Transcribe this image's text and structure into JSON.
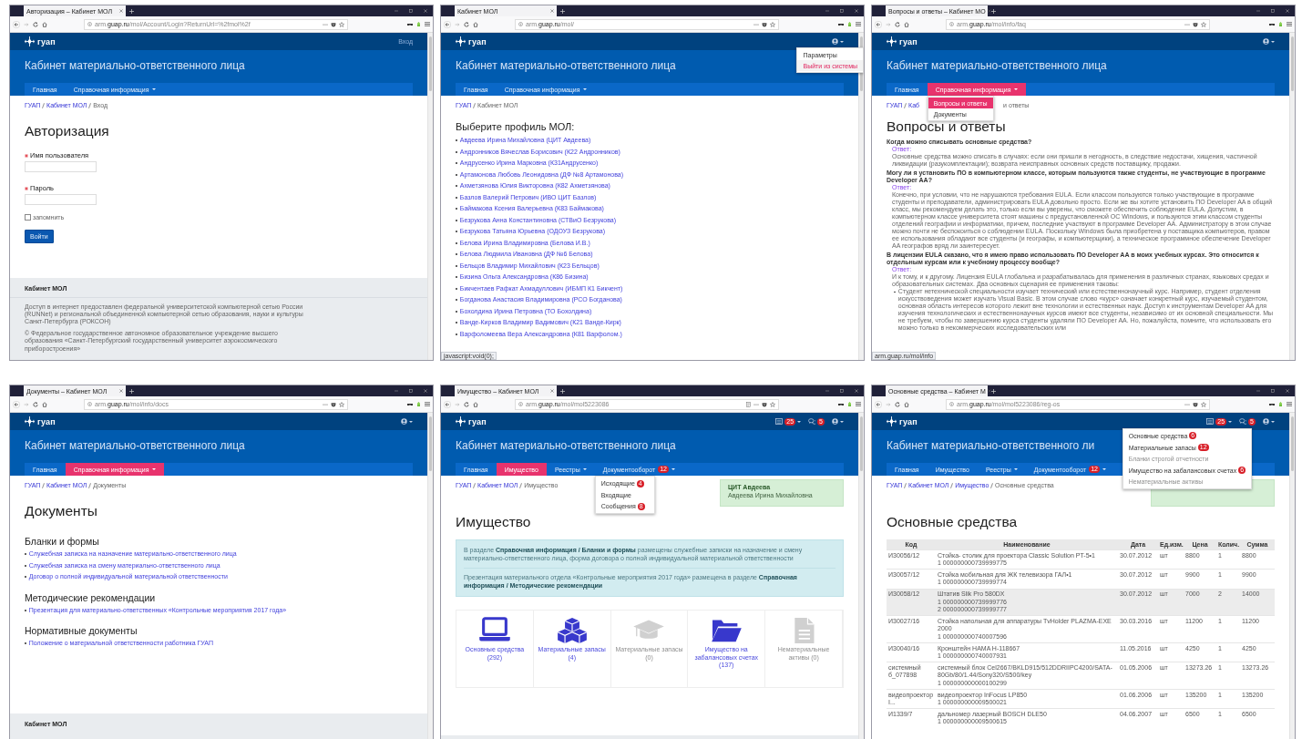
{
  "panels": [
    {
      "tab_title": "Авторизация – Кабинет МОЛ",
      "url": "arm.**guap.ru**/mol/Account/Login?ReturnUrl=%2fmol%2f",
      "reader_view": false,
      "logo": "гуап",
      "header_items": [
        {
          "kind": "link",
          "label": "Вход"
        }
      ],
      "site_title": "Кабинет материально-ответственного лица",
      "nav": [
        {
          "label": "Главная",
          "selected": false,
          "caret": false
        },
        {
          "label": "Справочная информация",
          "selected": false,
          "caret": true
        }
      ],
      "breadcrumb": [
        {
          "text": "ГУАП",
          "kind": "link"
        },
        {
          "text": "Кабинет МОЛ",
          "kind": "link"
        },
        {
          "text": "Вход",
          "kind": "current"
        }
      ],
      "body": {
        "kind": "login",
        "heading": "Авторизация",
        "fields": [
          {
            "label": "Имя пользователя",
            "required": true
          },
          {
            "label": "Пароль",
            "required": true
          }
        ],
        "remember": {
          "label": "запомнить",
          "checked": false
        },
        "submit": "Войти"
      },
      "footer": {
        "kind": "full",
        "title": "Кабинет МОЛ",
        "paragraphs": [
          "Доступ в интернет предоставлен федеральной университетской компьютерной сетью России (RUNNet) и региональной объединенной компьютерной сетью образования, науки и культуры Санкт-Петербурга (РОКСОН)",
          "© Федеральное государственное автономное образовательное учреждение высшего образования «Санкт-Петербургский государственный университет аэрокосмического приборостроения»"
        ]
      }
    },
    {
      "tab_title": "Кабинет МОЛ",
      "url": "arm.**guap.ru**/mol/",
      "reader_view": false,
      "logo": "гуап",
      "header_items": [
        {
          "kind": "user",
          "caret": true,
          "menu": [
            {
              "label": "Параметры",
              "kind": "normal",
              "selected": false
            },
            {
              "label": "Выйти из системы",
              "kind": "danger",
              "selected": false
            }
          ]
        }
      ],
      "site_title": "Кабинет материально-ответственного лица",
      "nav": [
        {
          "label": "Главная",
          "selected": false,
          "caret": false
        },
        {
          "label": "Справочная информация",
          "selected": false,
          "caret": true
        }
      ],
      "breadcrumb": [
        {
          "text": "ГУАП",
          "kind": "link"
        },
        {
          "text": "Кабинет МОЛ",
          "kind": "current"
        }
      ],
      "body": {
        "kind": "profiles",
        "heading": "Выберите профиль МОЛ:",
        "items": [
          "Авдеева Ирина Михайловна (ЦИТ Авдеева)",
          "Андронников Вячеслав Борисович (К22 Андронников)",
          "Андрусенко Ирина Марковна (К31Андрусенко)",
          "Артамонова Любовь Леонидовна (ДФ №8 Артамонова)",
          "Ахметзянова Юлия Викторовна (К82 Ахметзянова)",
          "Базлов Валерий Петрович (ИВО ЦИТ Базлов)",
          "Баймакова Ксения Валерьевна (К83 Баймакова)",
          "Безрукова Анна Константиновна (СТВиО Безрукова)",
          "Безрукова Татьяна Юрьевна (ОДОУЗ Безрукова)",
          "Белова Ирина Владимировна (Белова И.В.)",
          "Белова Людмила Ивановна (ДФ №6 Белова)",
          "Бельцов Владимир Михайлович (К23 Бельцов)",
          "Бизина Ольга Александровна (К86 Бизина)",
          "Бикчентаев Рафкат Ахмадуллович (ИБМП К1 Бикчент)",
          "Богданова Анастасия Владимировна (РСО Богданова)",
          "Бохолдина Ирина Петровна (ТО Бохолдина)",
          "Ванде-Кирков Владимир Вадимович (К21 Ванде-Кирк)",
          "Варфоломеева Вера Александровна (К81 Варфолом.)"
        ]
      },
      "status_text": "javascript:void(0);"
    },
    {
      "tab_title": "Вопросы и ответы – Кабинет МО",
      "url": "arm.**guap.ru**/mol/info/faq",
      "reader_view": false,
      "logo": "гуап",
      "header_items": [
        {
          "kind": "user",
          "caret": true
        }
      ],
      "site_title": "Кабинет материально-ответственного лица",
      "nav": [
        {
          "label": "Главная",
          "selected": false,
          "caret": false
        },
        {
          "label": "Справочная информация",
          "selected": true,
          "caret": true,
          "menu": [
            {
              "label": "Вопросы и ответы",
              "kind": "normal",
              "selected": true
            },
            {
              "label": "Документы",
              "kind": "normal",
              "selected": false
            }
          ]
        }
      ],
      "breadcrumb": [
        {
          "text": "ГУАП",
          "kind": "link"
        },
        {
          "text": "Каб",
          "kind": "link"
        },
        {
          "text": "и ответы",
          "kind": "tail"
        }
      ],
      "body": {
        "kind": "faq",
        "heading": "Вопросы и ответы",
        "entries": [
          {
            "question": "Когда можно списывать основные средства?",
            "answer_label": "Ответ:",
            "answer": "Основные средства можно списать в случаях: если они пришли в негодность, в следствие недостачи, хищения, частичной ликвидации (разукомплектации); возврата неисправных основных средств поставщику, продажи."
          },
          {
            "question": "Могу ли я установить ПО в компьютерном классе, которым пользуются также студенты, не участвующие в программе Developer AA?",
            "answer_label": "Ответ:",
            "answer": "Конечно, при условии, что не нарушаются требования EULA. Если классом пользуются только участвующие в программе студенты и преподаватели, администрировать EULA довольно просто. Если же вы хотите установить ПО Developer AA в общий класс, мы рекомендуем делать это, только если вы уверены, что сможете обеспечить соблюдение EULA. Допустим, в компьютерном классе университета стоят машины с предустановленной ОС Windows, и пользуются этим классом студенты отделений географии и информатики, причем, последние участвуют в программе Developer AA. Администратору в этом случае можно почти не беспокоиться о соблюдении EULA. Поскольку Windows была приобретена у поставщика компьютеров, правом ее использования обладают все студенты (и географы, и компьютерщики), а техническое программное обеспечение Developer AA географов вряд ли заинтересует."
          },
          {
            "question": "В лицензии EULA сказано, что я имею право использовать ПО Developer AA в моих учебных курсах. Это относится к отдельным курсам или к учебному процессу вообще?",
            "answer_label": "Ответ:",
            "answer": "И к тому, и к другому. Лицензия EULA глобальна и разрабатывалась для применения в различных странах, языковых средах и образовательных системах. Два основных сценария ее применения таковы:",
            "bullets": [
              "Студент нетехнической специальности изучает технический или естественнонаучный курс. Например, студент отделения искусствоведения может изучать Visual Basic. В этом случае слово «курс» означает конкретный курс, изучаемый студентом, основная область интересов которого лежит вне технологии и естественных наук. Доступ к инструментам Developer AA для изучения технологических и естественнонаучных курсов имеют все студенты, независимо от их основной специальности. Мы не требуем, чтобы по завершению курса студенты удаляли ПО Developer AA. Но, пожалуйста, помните, что использовать его можно только в некоммерческих исследовательских или"
            ]
          }
        ]
      },
      "status_text": "arm.guap.ru/mol/info"
    },
    {
      "tab_title": "Документы – Кабинет МОЛ",
      "url": "arm.**guap.ru**/mol/info/docs",
      "reader_view": false,
      "logo": "гуап",
      "header_items": [
        {
          "kind": "user",
          "caret": true
        }
      ],
      "site_title": "Кабинет материально-ответственного лица",
      "nav": [
        {
          "label": "Главная",
          "selected": false,
          "caret": false
        },
        {
          "label": "Справочная информация",
          "selected": true,
          "caret": true
        }
      ],
      "breadcrumb": [
        {
          "text": "ГУАП",
          "kind": "link"
        },
        {
          "text": "Кабинет МОЛ",
          "kind": "link"
        },
        {
          "text": "Документы",
          "kind": "current"
        }
      ],
      "body": {
        "kind": "docs",
        "heading": "Документы",
        "sections": [
          {
            "title": "Бланки и формы",
            "links": [
              "Служебная записка на назначение материально-ответственного лица",
              "Служебная записка на смену материально-ответственного лица",
              "Договор о полной индивидуальной материальной ответственности"
            ]
          },
          {
            "title": "Методические рекомендации",
            "links": [
              "Презентация для материально-ответственных «Контрольные мероприятия 2017 года»"
            ]
          },
          {
            "title": "Нормативные документы",
            "links": [
              "Положение о материальной ответственности работника ГУАП"
            ]
          }
        ]
      },
      "footer": {
        "kind": "full",
        "title": "Кабинет МОЛ"
      }
    },
    {
      "tab_title": "Имущество – Кабинет МОЛ",
      "url": "arm.**guap.ru**/mol/mol5223086",
      "reader_view": true,
      "logo": "гуап",
      "header_items": [
        {
          "kind": "registry",
          "badge": "25",
          "caret": true
        },
        {
          "kind": "messages",
          "badge": "5",
          "caret": false
        },
        {
          "kind": "user",
          "caret": true
        }
      ],
      "site_title": "Кабинет материально-ответственного лица",
      "nav": [
        {
          "label": "Главная",
          "selected": false,
          "caret": false
        },
        {
          "label": "Имущество",
          "selected": true,
          "caret": false
        },
        {
          "label": "Реестры",
          "selected": false,
          "caret": true
        },
        {
          "label": "Документооборот",
          "selected": false,
          "caret": true,
          "badge": "12",
          "menu": [
            {
              "label": "Исходящие",
              "kind": "normal",
              "selected": false,
              "badge": "4"
            },
            {
              "label": "Входящие",
              "kind": "normal",
              "selected": false
            },
            {
              "label": "Сообщения",
              "kind": "normal",
              "selected": false,
              "badge": "8"
            }
          ]
        }
      ],
      "breadcrumb": [
        {
          "text": "ГУАП",
          "kind": "link"
        },
        {
          "text": "Кабинет МОЛ",
          "kind": "link"
        },
        {
          "text": "Имущество",
          "kind": "current"
        }
      ],
      "body": {
        "kind": "property",
        "owner": {
          "title": "ЦИТ Авдеева",
          "name": "Авдеева Ирина Михайловна"
        },
        "heading": "Имущество",
        "notes": [
          "В разделе **Справочная информация / Бланки и формы** размещены служебные записки на назначение и смену материально-ответственного лица, форма договора о полной индивидуальной материальной ответственности",
          "Презентация материального отдела «Контрольные мероприятия 2017 года» размещена в разделе **Справочная информация / Методические рекомендации**"
        ],
        "tiles": [
          {
            "label": "Основные средства (292)",
            "kind": "laptop",
            "disabled": false
          },
          {
            "label": "Материальные запасы (4)",
            "kind": "boxes",
            "disabled": false
          },
          {
            "label": "Материальные запасы (0)",
            "kind": "cap",
            "disabled": true
          },
          {
            "label": "Имущество на забалансовых счетах (137)",
            "kind": "folder",
            "disabled": false
          },
          {
            "label": "Нематериальные активы (0)",
            "kind": "file",
            "disabled": true
          }
        ]
      },
      "footer": {
        "kind": "band"
      }
    },
    {
      "tab_title": "Основные средства – Кабинет М",
      "url": "arm.**guap.ru**/mol/mol5223086/reg-os",
      "reader_view": false,
      "logo": "гуап",
      "header_items": [
        {
          "kind": "registry",
          "badge": "25",
          "caret": true,
          "menu": [
            {
              "label": "Основные средства",
              "kind": "normal",
              "selected": false,
              "badge": "6"
            },
            {
              "label": "Материальные запасы",
              "kind": "normal",
              "selected": false,
              "badge": "12"
            },
            {
              "label": "Бланки строгой отчетности",
              "kind": "disabled",
              "selected": false
            },
            {
              "label": "Имущество на забалансовых счетах",
              "kind": "normal",
              "selected": false,
              "badge": "6"
            },
            {
              "label": "Нематериальные активы",
              "kind": "disabled",
              "selected": false
            }
          ]
        },
        {
          "kind": "messages",
          "badge": "5",
          "caret": false
        },
        {
          "kind": "user",
          "caret": true
        }
      ],
      "site_title": "Кабинет материально-ответственного ли",
      "nav": [
        {
          "label": "Главная",
          "selected": false,
          "caret": false
        },
        {
          "label": "Имущество",
          "selected": false,
          "caret": false
        },
        {
          "label": "Реестры",
          "selected": false,
          "caret": true
        },
        {
          "label": "Документооборот",
          "selected": false,
          "caret": true,
          "badge": "12"
        }
      ],
      "breadcrumb": [
        {
          "text": "ГУАП",
          "kind": "link"
        },
        {
          "text": "Кабинет МОЛ",
          "kind": "link"
        },
        {
          "text": "Имущество",
          "kind": "link"
        },
        {
          "text": "Основные средства",
          "kind": "current"
        }
      ],
      "body": {
        "kind": "table",
        "owner_card": true,
        "heading": "Основные средства",
        "columns": [
          "Код",
          "Наименование",
          "Дата",
          "Ед.изм.",
          "Цена",
          "Колич.",
          "Сумма"
        ],
        "rows": [
          {
            "selected": false,
            "cells": [
              "И30056/12",
              "Стойка- столик для проектора Classic Solution PT-5•1\n1 000000000739999775",
              "30.07.2012",
              "шт",
              "8800",
              "1",
              "8800"
            ]
          },
          {
            "selected": false,
            "cells": [
              "И30057/12",
              "Стойка мобильная для ЖК телевизора ГАЛ•1\n1 000000000739999774",
              "30.07.2012",
              "шт",
              "9900",
              "1",
              "9900"
            ]
          },
          {
            "selected": true,
            "cells": [
              "И30058/12",
              "Штатив Slik Pro 580DX\n1 000000000739999776\n2 000000000739999777",
              "30.07.2012",
              "шт",
              "7000",
              "2",
              "14000"
            ]
          },
          {
            "selected": false,
            "cells": [
              "И30027/16",
              "Стойка напольная для аппаратуры TvHolder PLAZMA-EXE 2000\n1 000000000740007596",
              "30.03.2016",
              "шт",
              "11200",
              "1",
              "11200"
            ]
          },
          {
            "selected": false,
            "cells": [
              "И30040/16",
              "Кронштейн HAMA H-118667\n1 000000000740007931",
              "11.05.2016",
              "шт",
              "4250",
              "1",
              "4250"
            ]
          },
          {
            "selected": false,
            "cells": [
              "системный б_077898",
              "системный блок Cel2667/BKLD915/512DDRIIPC4200/SATA-80Gb/80/1.44/Sony320/S500/key\n1 000000000000100299",
              "01.05.2006",
              "шт",
              "13273.26",
              "1",
              "13273.26"
            ]
          },
          {
            "selected": false,
            "cells": [
              "видеопроектор I...",
              "видеопроектор InFocus LP850\n1 000000000009500021",
              "01.06.2006",
              "шт",
              "135200",
              "1",
              "135200"
            ]
          },
          {
            "selected": false,
            "cells": [
              "И1339/7",
              "дальномер лазерный BOSCH DLE50\n1 000000000009500615",
              "04.06.2007",
              "шт",
              "6500",
              "1",
              "6500"
            ]
          }
        ]
      }
    }
  ]
}
